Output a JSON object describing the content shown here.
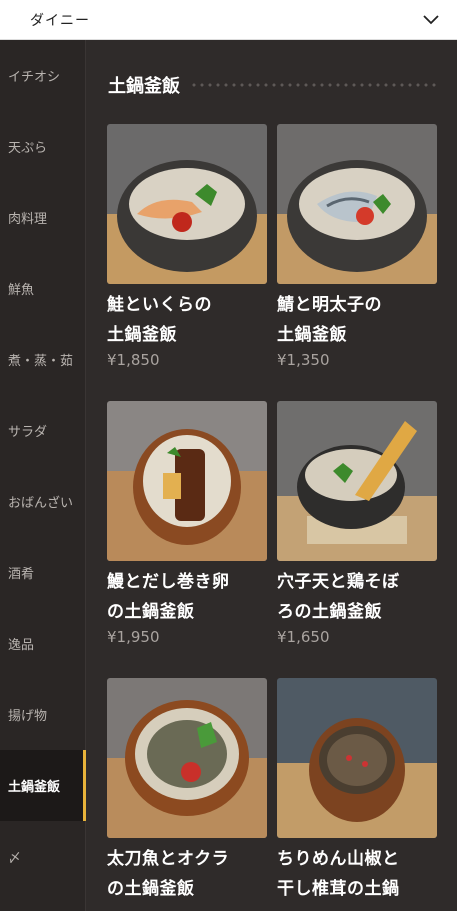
{
  "header": {
    "title": "ダイニー"
  },
  "sidebar": {
    "items": [
      {
        "label": "イチオシ"
      },
      {
        "label": "天ぷら"
      },
      {
        "label": "肉料理"
      },
      {
        "label": "鮮魚"
      },
      {
        "label": "煮・蒸・茹"
      },
      {
        "label": "サラダ"
      },
      {
        "label": "おばんざい"
      },
      {
        "label": "酒肴"
      },
      {
        "label": "逸品"
      },
      {
        "label": "揚げ物"
      },
      {
        "label": "土鍋釜飯"
      },
      {
        "label": "〆"
      }
    ],
    "active_index": 10
  },
  "section": {
    "title": "土鍋釜飯"
  },
  "menu": {
    "items": [
      {
        "name_line1": "鮭といくらの",
        "name_line2": "土鍋釜飯",
        "price": "¥1,850"
      },
      {
        "name_line1": "鯖と明太子の",
        "name_line2": "土鍋釜飯",
        "price": "¥1,350"
      },
      {
        "name_line1": "鰻とだし巻き卵",
        "name_line2": "の土鍋釜飯",
        "price": "¥1,950"
      },
      {
        "name_line1": "穴子天と鶏そぼ",
        "name_line2": "ろの土鍋釜飯",
        "price": "¥1,650"
      },
      {
        "name_line1": "太刀魚とオクラ",
        "name_line2": "の土鍋釜飯",
        "price": ""
      },
      {
        "name_line1": "ちりめん山椒と",
        "name_line2": "干し椎茸の土鍋",
        "price": ""
      }
    ]
  },
  "colors": {
    "accent": "#e8b33a",
    "background": "#2f2b2a",
    "sidebar": "#2a2625"
  }
}
